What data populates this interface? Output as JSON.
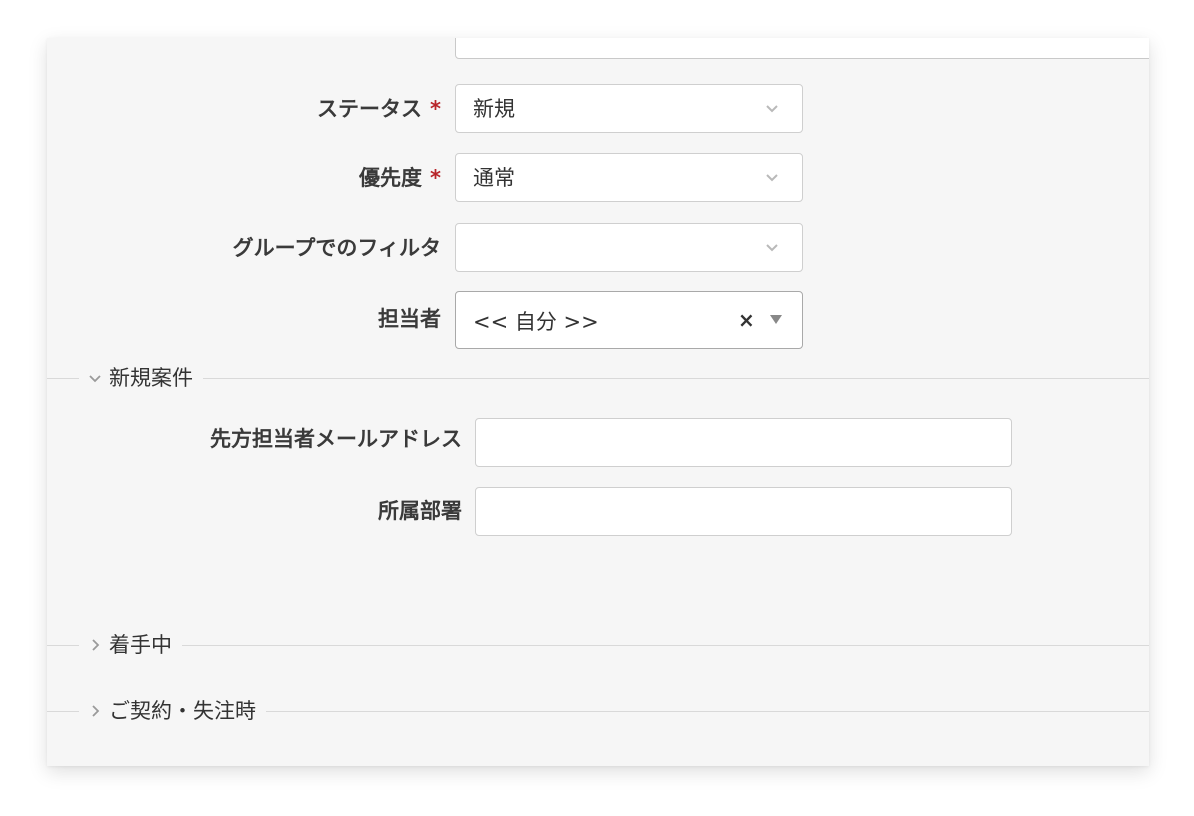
{
  "form": {
    "status": {
      "label": "ステータス",
      "required_mark": "*",
      "value": "新規"
    },
    "priority": {
      "label": "優先度",
      "required_mark": "*",
      "value": "通常"
    },
    "group_filter": {
      "label": "グループでのフィルタ",
      "value": ""
    },
    "assignee": {
      "label": "担当者",
      "value": "<< 自分 >>",
      "clear": "×"
    }
  },
  "sections": {
    "new_case": {
      "title": "新規案件",
      "expanded": true,
      "fields": {
        "email": {
          "label": "先方担当者メールアドレス",
          "value": ""
        },
        "department": {
          "label": "所属部署",
          "value": ""
        }
      }
    },
    "in_progress": {
      "title": "着手中",
      "expanded": false
    },
    "contract": {
      "title": "ご契約・失注時",
      "expanded": false
    }
  },
  "colors": {
    "required": "#b8252a",
    "border": "#cfcfcf",
    "background": "#f6f6f6"
  },
  "icons": {
    "select_chevron": "chevron-down-icon",
    "section_expanded": "chevron-down-icon",
    "section_collapsed": "chevron-right-icon"
  }
}
